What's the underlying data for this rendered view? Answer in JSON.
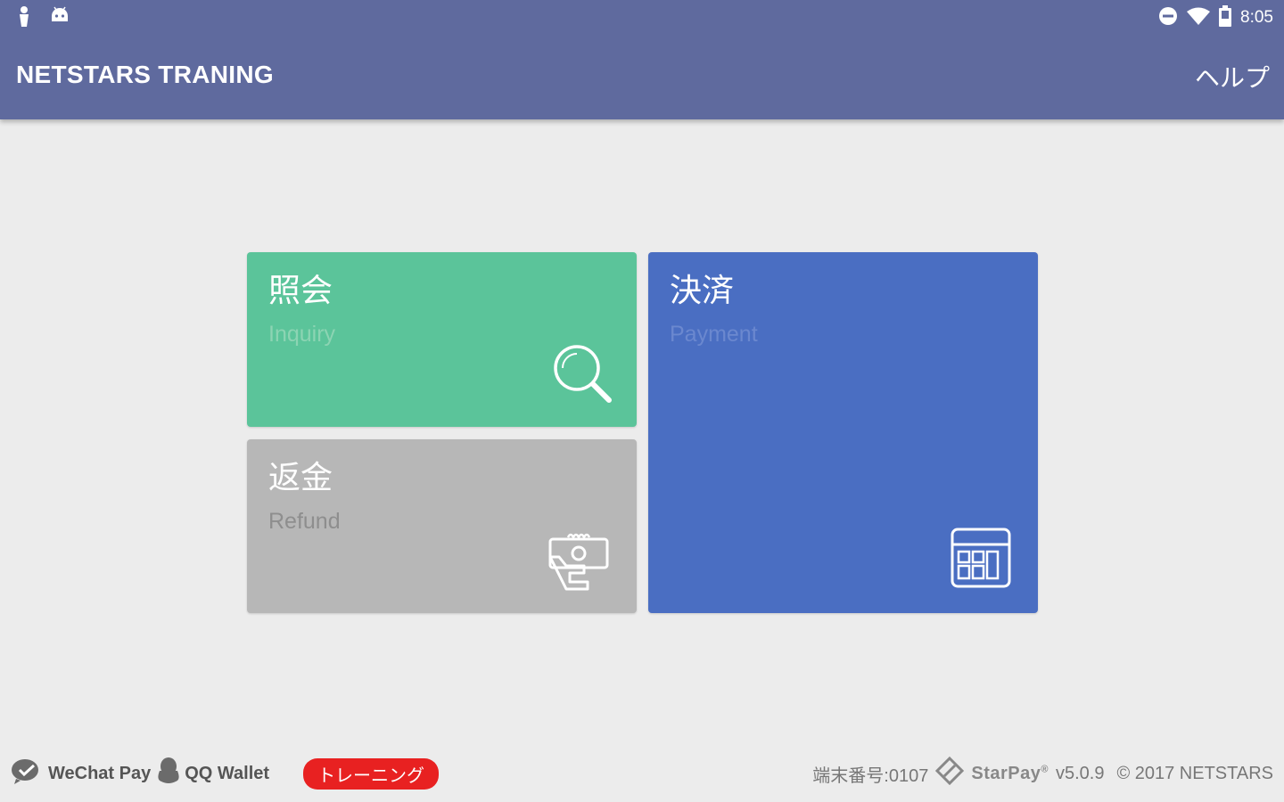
{
  "status_bar": {
    "time": "8:05",
    "icons": [
      "notification-icon",
      "android-icon",
      "do-not-disturb-icon",
      "wifi-icon",
      "battery-icon"
    ]
  },
  "app_bar": {
    "title": "NETSTARS TRANING",
    "help_label": "ヘルプ",
    "color": "#5f6a9e"
  },
  "tiles": {
    "inquiry": {
      "jp": "照会",
      "en": "Inquiry",
      "icon": "magnifier-icon",
      "color": "#5bc49a"
    },
    "refund": {
      "jp": "返金",
      "en": "Refund",
      "icon": "cash-hand-icon",
      "color": "#b7b7b7"
    },
    "payment": {
      "jp": "決済",
      "en": "Payment",
      "icon": "calculator-icon",
      "color": "#4a6ec2"
    }
  },
  "footer": {
    "wechat_label": "WeChat Pay",
    "qq_label": "QQ Wallet",
    "training_badge": "トレーニング",
    "terminal": "端末番号:0107",
    "brand": "StarPay",
    "brand_mark": "®",
    "version": "v5.0.9",
    "copyright": "© 2017 NETSTARS",
    "badge_color": "#e82121"
  }
}
